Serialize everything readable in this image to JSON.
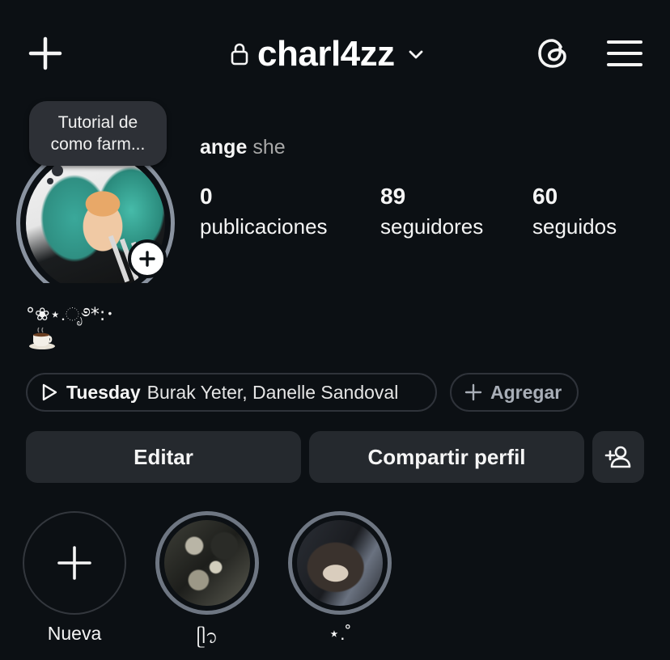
{
  "header": {
    "username": "charl4zz",
    "icons": [
      "plus-icon",
      "lock-icon",
      "chevron-down-icon",
      "threads-icon",
      "hamburger-menu-icon"
    ]
  },
  "note": {
    "line1": "Tutorial de",
    "line2": "como farm..."
  },
  "profile": {
    "name": "ange",
    "pronouns": "she",
    "stats": [
      {
        "value": "0",
        "label": "publicaciones"
      },
      {
        "value": "89",
        "label": "seguidores"
      },
      {
        "value": "60",
        "label": "seguidos"
      }
    ],
    "bio_line1": "°❀⋆.ೃ࿔*:･",
    "bio_line2_icon": "coffee-cup-icon"
  },
  "music": {
    "day": "Tuesday",
    "artists": "Burak Yeter, Danelle Sandoval",
    "add_label": "Agregar"
  },
  "actions": {
    "edit_label": "Editar",
    "share_label": "Compartir perfil"
  },
  "highlights": [
    {
      "label": "Nueva"
    },
    {
      "label": "ᥫ᭡"
    },
    {
      "label": "⋆.˚"
    }
  ],
  "colors": {
    "background": "#0c1014",
    "button_bg": "#25292e",
    "note_bg": "#2d3036",
    "secondary_text": "#a8a8a8"
  }
}
